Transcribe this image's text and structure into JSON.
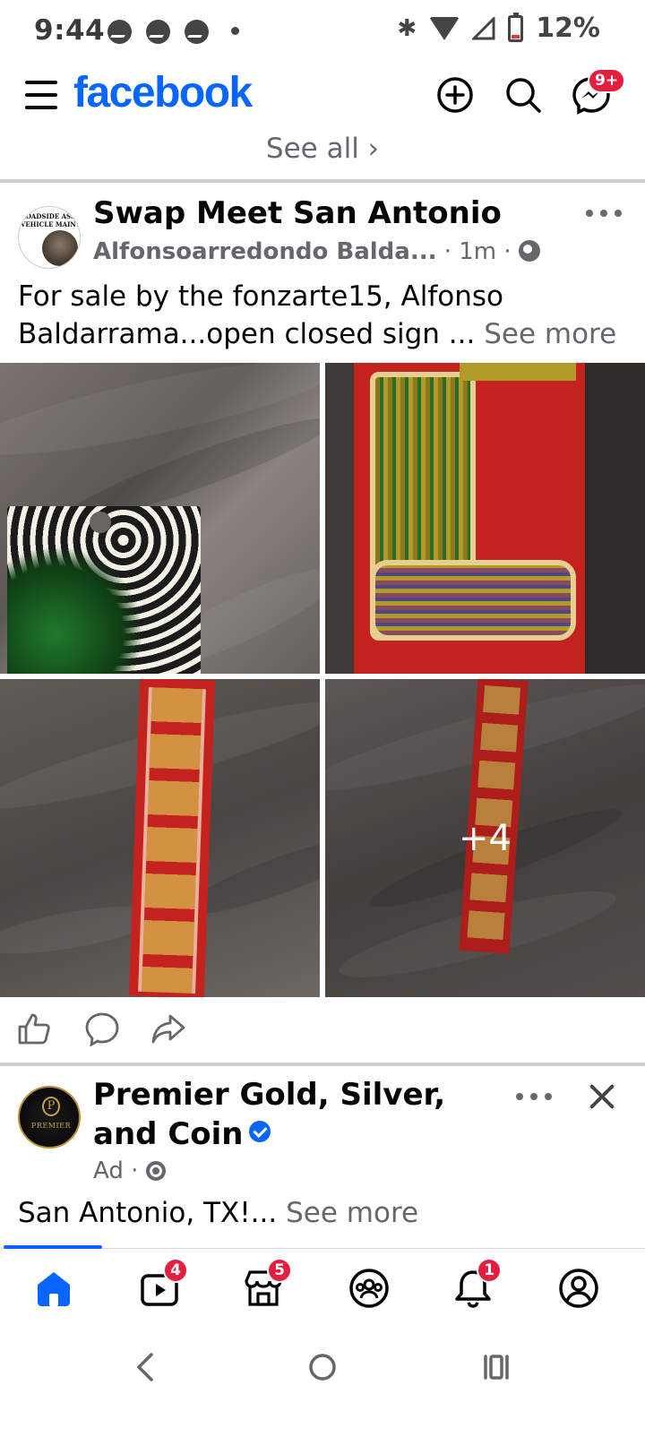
{
  "status_bar": {
    "time": "9:44",
    "battery_pct": "12%",
    "icons": [
      "messenger-icon",
      "messenger-icon",
      "messenger-icon",
      "dot-icon",
      "bluetooth-icon",
      "wifi-icon",
      "signal-icon",
      "battery-icon"
    ]
  },
  "header": {
    "logo": "facebook",
    "messenger_badge": "9+",
    "brand_color": "#0866ff"
  },
  "feed": {
    "see_all": "See all ›",
    "post": {
      "group_name": "Swap Meet San Antonio",
      "author": "Alfonsoarredondo Balda...",
      "time": "· 1m ·",
      "text": "For sale by the fonzarte15, Alfonso Baldarrama...open closed sign ...",
      "see_more": "See more",
      "more_photos": "+4",
      "avatar_text": "ROADSIDE ASSIST\nVEHICLE MAINTENANCE"
    },
    "ad": {
      "name": "Premier Gold, Silver, and Coin",
      "label": "Ad ·",
      "text": "San Antonio, TX!...",
      "see_more": "See more",
      "avatar_letter": "P",
      "avatar_word": "PREMIER"
    }
  },
  "bottom_nav": {
    "active_tab": "home",
    "video_badge": "4",
    "marketplace_badge": "5",
    "notifications_badge": "1"
  }
}
